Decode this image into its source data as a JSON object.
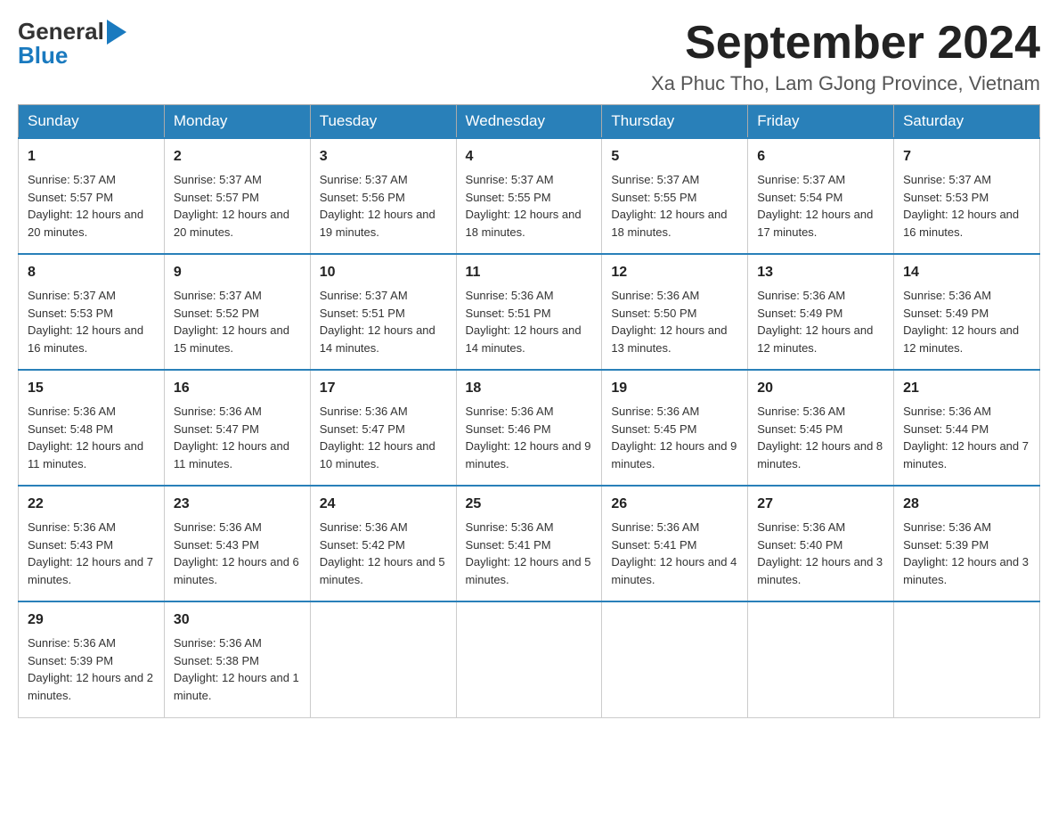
{
  "header": {
    "logo_general": "General",
    "logo_blue": "Blue",
    "month_title": "September 2024",
    "location": "Xa Phuc Tho, Lam GJong Province, Vietnam"
  },
  "days_of_week": [
    "Sunday",
    "Monday",
    "Tuesday",
    "Wednesday",
    "Thursday",
    "Friday",
    "Saturday"
  ],
  "weeks": [
    [
      {
        "day": "1",
        "sunrise": "Sunrise: 5:37 AM",
        "sunset": "Sunset: 5:57 PM",
        "daylight": "Daylight: 12 hours and 20 minutes."
      },
      {
        "day": "2",
        "sunrise": "Sunrise: 5:37 AM",
        "sunset": "Sunset: 5:57 PM",
        "daylight": "Daylight: 12 hours and 20 minutes."
      },
      {
        "day": "3",
        "sunrise": "Sunrise: 5:37 AM",
        "sunset": "Sunset: 5:56 PM",
        "daylight": "Daylight: 12 hours and 19 minutes."
      },
      {
        "day": "4",
        "sunrise": "Sunrise: 5:37 AM",
        "sunset": "Sunset: 5:55 PM",
        "daylight": "Daylight: 12 hours and 18 minutes."
      },
      {
        "day": "5",
        "sunrise": "Sunrise: 5:37 AM",
        "sunset": "Sunset: 5:55 PM",
        "daylight": "Daylight: 12 hours and 18 minutes."
      },
      {
        "day": "6",
        "sunrise": "Sunrise: 5:37 AM",
        "sunset": "Sunset: 5:54 PM",
        "daylight": "Daylight: 12 hours and 17 minutes."
      },
      {
        "day": "7",
        "sunrise": "Sunrise: 5:37 AM",
        "sunset": "Sunset: 5:53 PM",
        "daylight": "Daylight: 12 hours and 16 minutes."
      }
    ],
    [
      {
        "day": "8",
        "sunrise": "Sunrise: 5:37 AM",
        "sunset": "Sunset: 5:53 PM",
        "daylight": "Daylight: 12 hours and 16 minutes."
      },
      {
        "day": "9",
        "sunrise": "Sunrise: 5:37 AM",
        "sunset": "Sunset: 5:52 PM",
        "daylight": "Daylight: 12 hours and 15 minutes."
      },
      {
        "day": "10",
        "sunrise": "Sunrise: 5:37 AM",
        "sunset": "Sunset: 5:51 PM",
        "daylight": "Daylight: 12 hours and 14 minutes."
      },
      {
        "day": "11",
        "sunrise": "Sunrise: 5:36 AM",
        "sunset": "Sunset: 5:51 PM",
        "daylight": "Daylight: 12 hours and 14 minutes."
      },
      {
        "day": "12",
        "sunrise": "Sunrise: 5:36 AM",
        "sunset": "Sunset: 5:50 PM",
        "daylight": "Daylight: 12 hours and 13 minutes."
      },
      {
        "day": "13",
        "sunrise": "Sunrise: 5:36 AM",
        "sunset": "Sunset: 5:49 PM",
        "daylight": "Daylight: 12 hours and 12 minutes."
      },
      {
        "day": "14",
        "sunrise": "Sunrise: 5:36 AM",
        "sunset": "Sunset: 5:49 PM",
        "daylight": "Daylight: 12 hours and 12 minutes."
      }
    ],
    [
      {
        "day": "15",
        "sunrise": "Sunrise: 5:36 AM",
        "sunset": "Sunset: 5:48 PM",
        "daylight": "Daylight: 12 hours and 11 minutes."
      },
      {
        "day": "16",
        "sunrise": "Sunrise: 5:36 AM",
        "sunset": "Sunset: 5:47 PM",
        "daylight": "Daylight: 12 hours and 11 minutes."
      },
      {
        "day": "17",
        "sunrise": "Sunrise: 5:36 AM",
        "sunset": "Sunset: 5:47 PM",
        "daylight": "Daylight: 12 hours and 10 minutes."
      },
      {
        "day": "18",
        "sunrise": "Sunrise: 5:36 AM",
        "sunset": "Sunset: 5:46 PM",
        "daylight": "Daylight: 12 hours and 9 minutes."
      },
      {
        "day": "19",
        "sunrise": "Sunrise: 5:36 AM",
        "sunset": "Sunset: 5:45 PM",
        "daylight": "Daylight: 12 hours and 9 minutes."
      },
      {
        "day": "20",
        "sunrise": "Sunrise: 5:36 AM",
        "sunset": "Sunset: 5:45 PM",
        "daylight": "Daylight: 12 hours and 8 minutes."
      },
      {
        "day": "21",
        "sunrise": "Sunrise: 5:36 AM",
        "sunset": "Sunset: 5:44 PM",
        "daylight": "Daylight: 12 hours and 7 minutes."
      }
    ],
    [
      {
        "day": "22",
        "sunrise": "Sunrise: 5:36 AM",
        "sunset": "Sunset: 5:43 PM",
        "daylight": "Daylight: 12 hours and 7 minutes."
      },
      {
        "day": "23",
        "sunrise": "Sunrise: 5:36 AM",
        "sunset": "Sunset: 5:43 PM",
        "daylight": "Daylight: 12 hours and 6 minutes."
      },
      {
        "day": "24",
        "sunrise": "Sunrise: 5:36 AM",
        "sunset": "Sunset: 5:42 PM",
        "daylight": "Daylight: 12 hours and 5 minutes."
      },
      {
        "day": "25",
        "sunrise": "Sunrise: 5:36 AM",
        "sunset": "Sunset: 5:41 PM",
        "daylight": "Daylight: 12 hours and 5 minutes."
      },
      {
        "day": "26",
        "sunrise": "Sunrise: 5:36 AM",
        "sunset": "Sunset: 5:41 PM",
        "daylight": "Daylight: 12 hours and 4 minutes."
      },
      {
        "day": "27",
        "sunrise": "Sunrise: 5:36 AM",
        "sunset": "Sunset: 5:40 PM",
        "daylight": "Daylight: 12 hours and 3 minutes."
      },
      {
        "day": "28",
        "sunrise": "Sunrise: 5:36 AM",
        "sunset": "Sunset: 5:39 PM",
        "daylight": "Daylight: 12 hours and 3 minutes."
      }
    ],
    [
      {
        "day": "29",
        "sunrise": "Sunrise: 5:36 AM",
        "sunset": "Sunset: 5:39 PM",
        "daylight": "Daylight: 12 hours and 2 minutes."
      },
      {
        "day": "30",
        "sunrise": "Sunrise: 5:36 AM",
        "sunset": "Sunset: 5:38 PM",
        "daylight": "Daylight: 12 hours and 1 minute."
      },
      null,
      null,
      null,
      null,
      null
    ]
  ]
}
